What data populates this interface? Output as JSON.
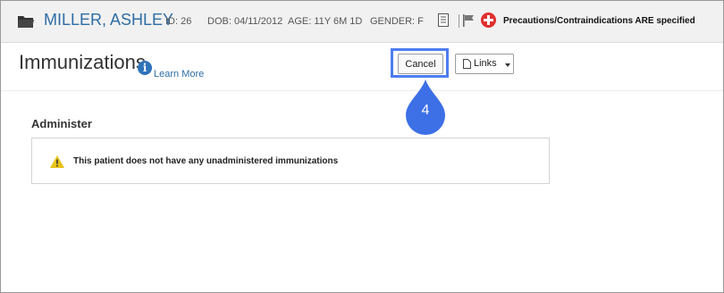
{
  "patient": {
    "name": "MILLER, ASHLEY",
    "id": "ID: 26",
    "dob": "DOB: 04/11/2012",
    "age": "AGE: 11Y 6M 1D",
    "gender": "GENDER: F",
    "precautions": "Precautions/Contraindications ARE specified",
    "icons": [
      "folder-icon",
      "document-icon",
      "flag-icon",
      "plus-circle-icon"
    ]
  },
  "page": {
    "title": "Immunizations",
    "learn_more": "Learn More",
    "info_glyph": "i"
  },
  "toolbar": {
    "cancel_label": "Cancel",
    "links_label": "Links"
  },
  "step_marker": {
    "number": "4",
    "color": "#3d6fe6"
  },
  "administer": {
    "heading": "Administer",
    "message": "This patient does not have any unadministered immunizations"
  },
  "colors": {
    "link": "#2e6da4",
    "highlight": "#4d7df0",
    "warning": "#e8c21a",
    "danger": "#e0302e"
  }
}
